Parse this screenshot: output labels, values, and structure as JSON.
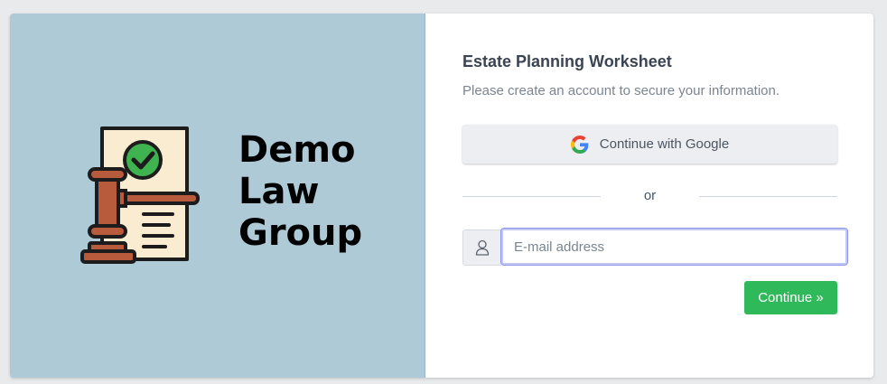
{
  "brand": {
    "lines": [
      "Demo",
      "Law",
      "Group"
    ]
  },
  "form": {
    "title": "Estate Planning Worksheet",
    "subtitle": "Please create an account to secure your information.",
    "google_label": "Continue with Google",
    "divider_text": "or",
    "email_placeholder": "E-mail address",
    "email_value": "",
    "continue_label": "Continue »"
  },
  "icons": {
    "logo": "gavel-document-check-icon",
    "google": "google-icon",
    "user": "user-icon"
  },
  "colors": {
    "left_panel_bg": "#adcad6",
    "continue_green": "#2fb95a",
    "google_btn_bg": "#eceef1",
    "check_green": "#3fb34f",
    "gavel_brown": "#b85a3c"
  }
}
